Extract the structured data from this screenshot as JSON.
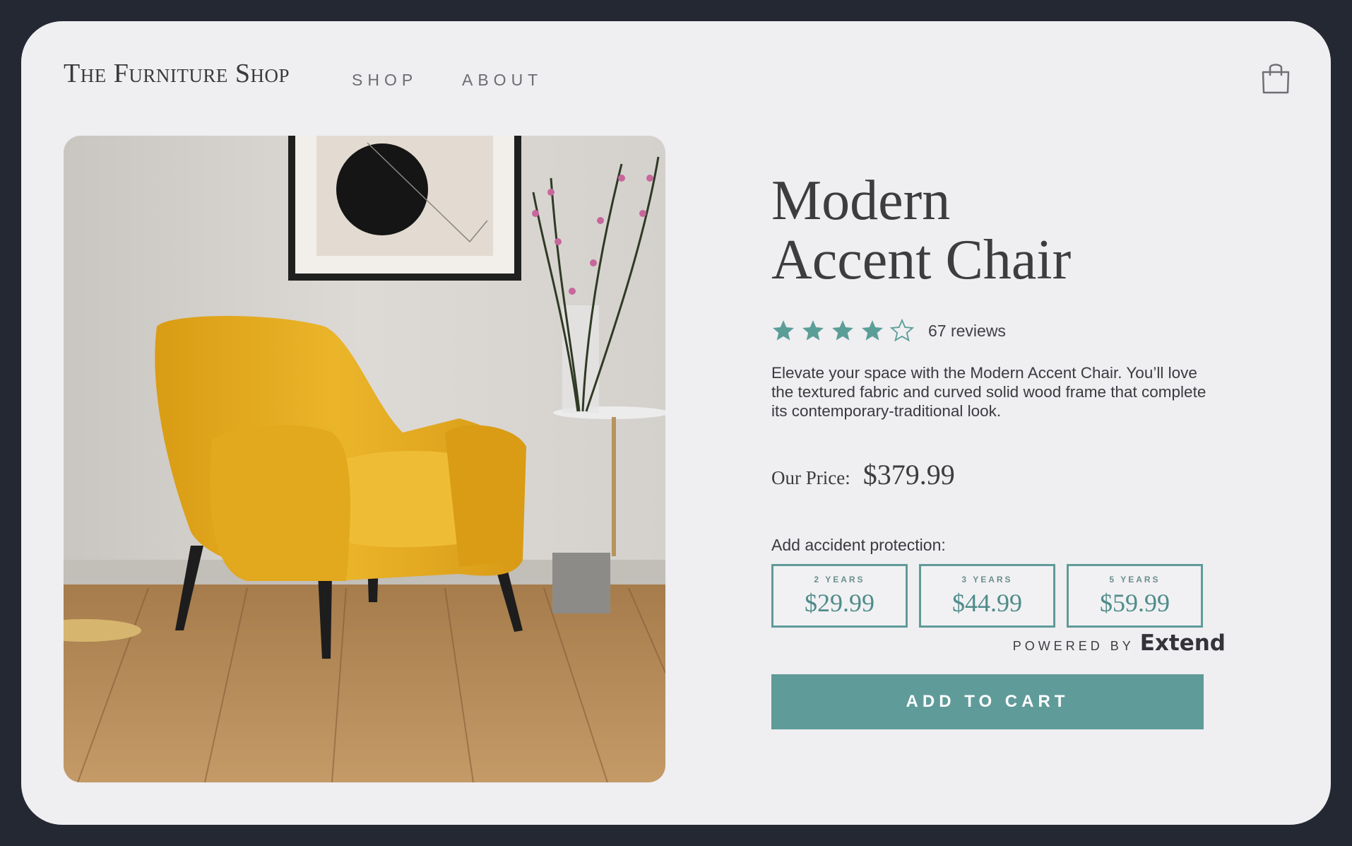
{
  "header": {
    "brand": "The Furniture Shop",
    "nav": [
      {
        "label": "SHOP"
      },
      {
        "label": "ABOUT"
      }
    ],
    "cart_icon": "shopping-bag-icon"
  },
  "product": {
    "image": "yellow-accent-chair-photo",
    "title_line1": "Modern",
    "title_line2": "Accent Chair",
    "rating": {
      "value": 4,
      "max": 5
    },
    "reviews_text": "67 reviews",
    "description": "Elevate your space with the Modern Accent Chair. You’ll love the textured fabric and curved solid wood frame that complete its contemporary-traditional look.",
    "price_label": "Our Price:",
    "price": "$379.99"
  },
  "protection": {
    "label": "Add accident protection:",
    "plans": [
      {
        "term": "2 YEARS",
        "price": "$29.99"
      },
      {
        "term": "3 YEARS",
        "price": "$44.99"
      },
      {
        "term": "5 YEARS",
        "price": "$59.99"
      }
    ],
    "powered_by": "POWERED BY",
    "powered_brand": "Extend"
  },
  "actions": {
    "add_to_cart": "ADD TO CART"
  },
  "colors": {
    "accent": "#5f9b99",
    "star": "#5b9e98",
    "frame": "#242833",
    "background": "#efeef1",
    "chair": "#e6b01f"
  }
}
